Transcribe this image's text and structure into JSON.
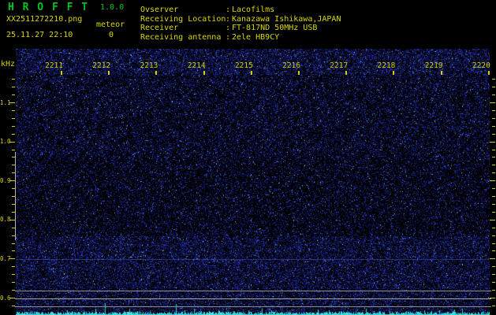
{
  "header": {
    "app_title": "H R O F F T",
    "app_version": "1.0.0",
    "filename": "XX2511272210.png",
    "meteor_label": "meteor",
    "meteor_count": "0",
    "datetime": "25.11.27 22:10",
    "info": [
      {
        "label": "Ovserver",
        "value": "Lacofilms"
      },
      {
        "label": "Receiving Location",
        "value": "Kanazawa Ishikawa,JAPAN"
      },
      {
        "label": "Receiver",
        "value": "FT-817ND 50MHz USB"
      },
      {
        "label": "Receiving antenna",
        "value": "2ele HB9CY"
      }
    ]
  },
  "chart_data": {
    "type": "heatmap",
    "title": "HROFFT 50 MHz radio meteor echo spectrogram (10-minute window), no meteor echoes detected",
    "x_axis": {
      "unit": "hhmm",
      "ticks": [
        "2211",
        "2212",
        "2213",
        "2214",
        "2215",
        "2216",
        "2217",
        "2218",
        "2219",
        "2220"
      ],
      "range": [
        "2210",
        "2220"
      ]
    },
    "y_axis": {
      "label": "kHz",
      "ticks": [
        "1.1",
        "1.0",
        "0.9",
        "0.8",
        "0.7",
        "0.6"
      ],
      "range_khz": [
        0.57,
        1.24
      ],
      "minor_tick_step_khz": 0.02
    },
    "meteor_count": 0,
    "background": "dark blue random noise floor, denser near top and bottom",
    "horizontal_carrier_lines_khz": [
      0.62,
      0.6,
      0.58
    ],
    "faint_line_khz": 0.7,
    "signal_level_trace": {
      "position": "bottom strip",
      "color_name": "cyan",
      "description": "jagged signal-strength baseline",
      "spike_times_approx": [
        "2211.9",
        "2213.4"
      ]
    }
  },
  "colors": {
    "title_green": "#00c41c",
    "text_yellow": "#d8d800",
    "axis_yellow": "#d0d000",
    "trace_cyan": "#2fd8d8",
    "carrier_gray": "#9f9f9f",
    "background": "#000000"
  }
}
